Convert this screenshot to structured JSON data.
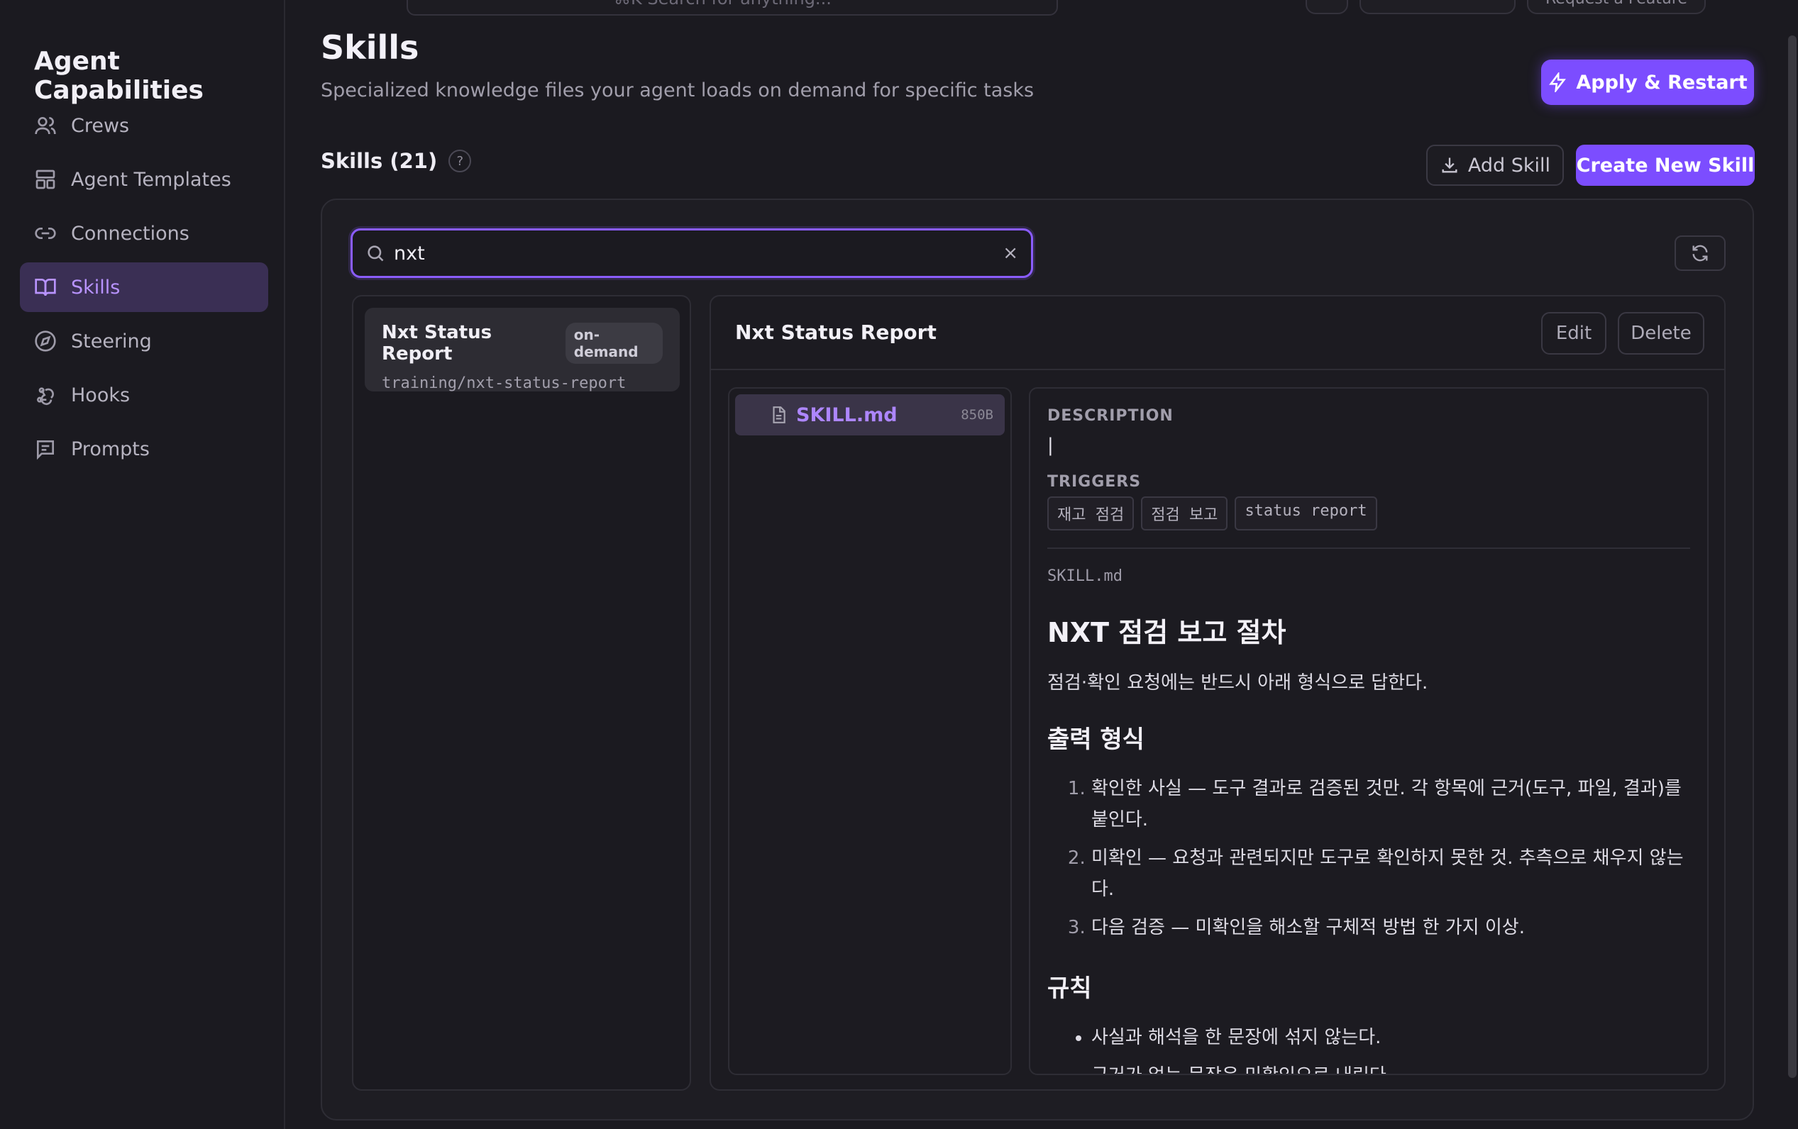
{
  "topbar": {
    "search_placeholder": "⌘K   Search for anything...",
    "chip_a": "",
    "chip_b": "Request a Feature"
  },
  "sidebar": {
    "title": "Agent Capabilities",
    "items": [
      {
        "label": "Crews",
        "icon": "users-icon"
      },
      {
        "label": "Agent Templates",
        "icon": "layout-icon"
      },
      {
        "label": "Connections",
        "icon": "link-icon"
      },
      {
        "label": "Skills",
        "icon": "book-icon",
        "active": true
      },
      {
        "label": "Steering",
        "icon": "compass-icon"
      },
      {
        "label": "Hooks",
        "icon": "webhook-icon"
      },
      {
        "label": "Prompts",
        "icon": "message-icon"
      }
    ]
  },
  "header": {
    "title": "Skills",
    "subtitle": "Specialized knowledge files your agent loads on demand for specific tasks",
    "apply_label": "Apply & Restart"
  },
  "section": {
    "title": "Skills (21)",
    "help": "?",
    "add_label": "Add Skill",
    "create_label": "Create New Skill"
  },
  "search": {
    "value": "nxt",
    "clear": "×"
  },
  "list": {
    "items": [
      {
        "name": "Nxt Status Report",
        "badge": "on-demand",
        "path": "training/nxt-status-report"
      }
    ]
  },
  "detail": {
    "title": "Nxt Status Report",
    "edit_label": "Edit",
    "delete_label": "Delete",
    "files": [
      {
        "name": "SKILL.md",
        "size": "850B"
      }
    ],
    "description_label": "DESCRIPTION",
    "description_value": "|",
    "triggers_label": "TRIGGERS",
    "triggers": [
      "재고 점검",
      "점검 보고",
      "status report"
    ],
    "md_filename": "SKILL.md",
    "md": {
      "h1": "NXT 점검 보고 절차",
      "p1": "점검·확인 요청에는 반드시 아래 형식으로 답한다.",
      "h2_format": "출력 형식",
      "ol": [
        "확인한 사실 — 도구 결과로 검증된 것만. 각 항목에 근거(도구, 파일, 결과)를 붙인다.",
        "미확인 — 요청과 관련되지만 도구로 확인하지 못한 것. 추측으로 채우지 않는다.",
        "다음 검증 — 미확인을 해소할 구체적 방법 한 가지 이상."
      ],
      "h2_rules": "규칙",
      "ul": [
        "사실과 해석을 한 문장에 섞지 않는다.",
        "근거가 없는 문장은 미확인으로 내린다."
      ]
    }
  },
  "colors": {
    "accent": "#7c4dff",
    "accent_text": "#b893ff",
    "background": "#1b1a20"
  }
}
